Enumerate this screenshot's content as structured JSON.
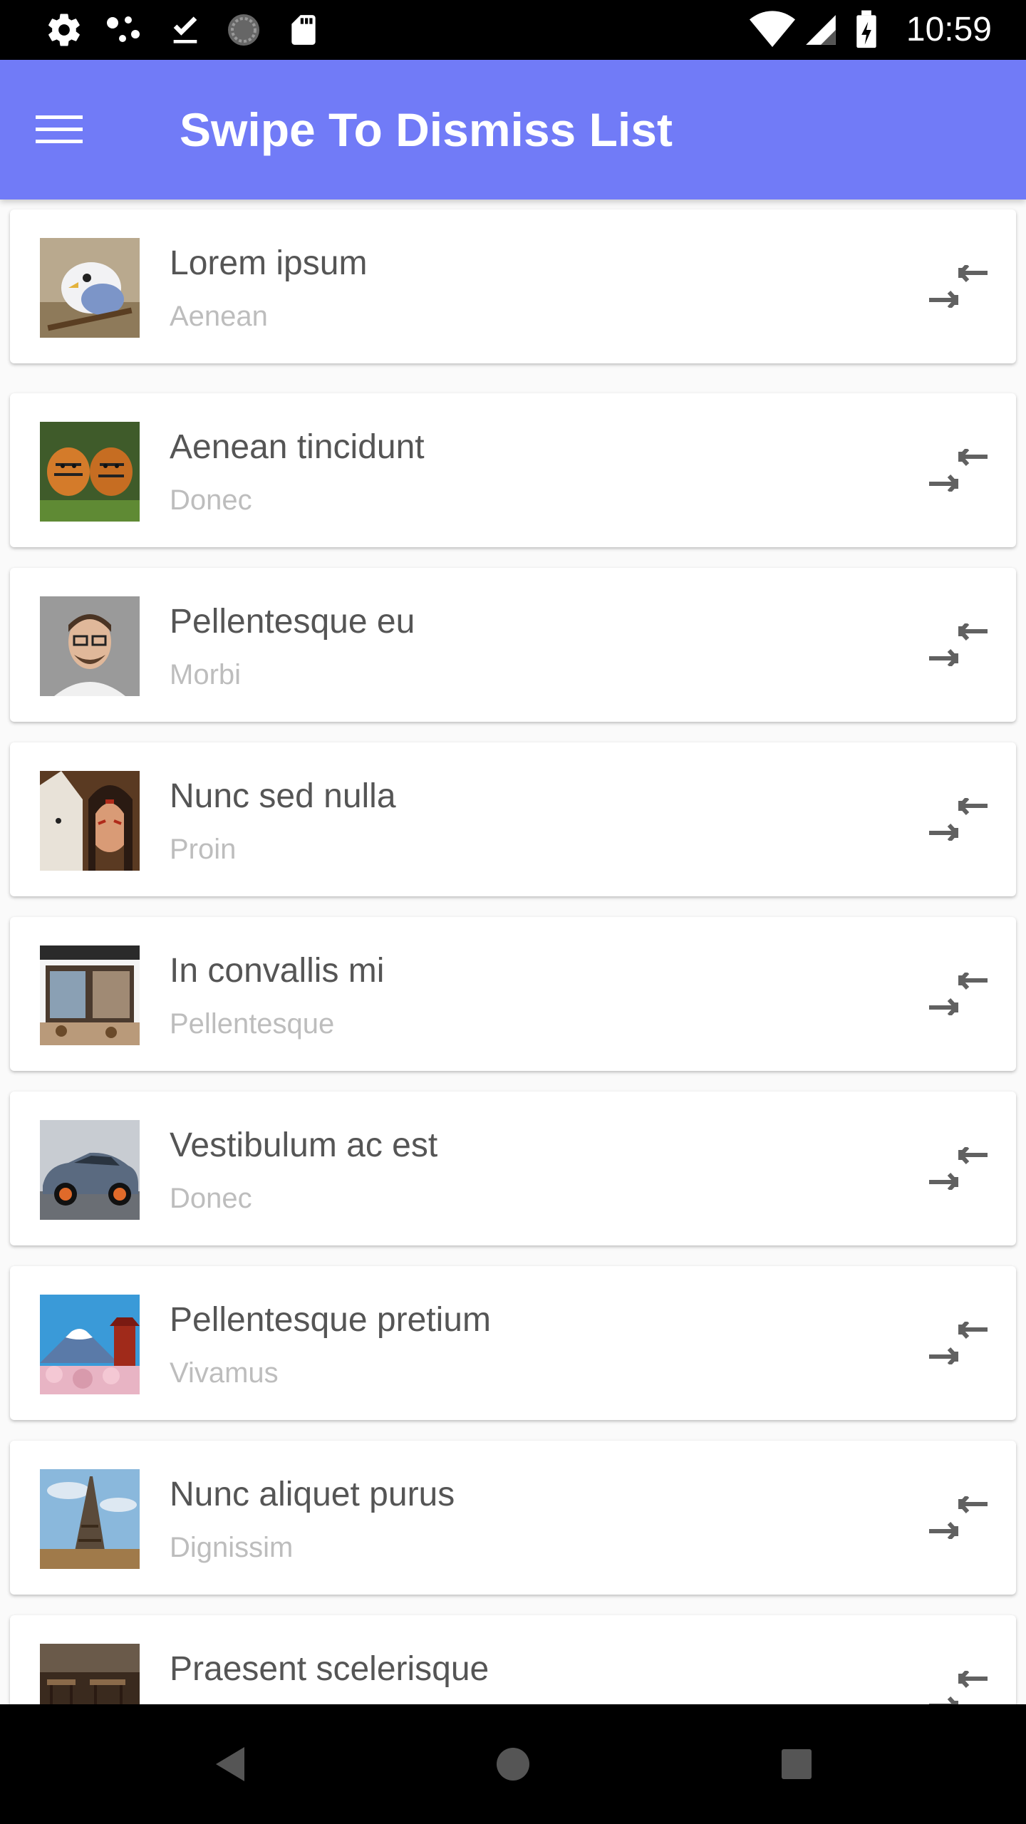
{
  "status_bar": {
    "time": "10:59",
    "icons": [
      "gear-icon",
      "dots-icon",
      "download-done-icon",
      "sync-circle-icon",
      "sd-card-icon",
      "wifi-icon",
      "signal-icon",
      "battery-charging-icon"
    ]
  },
  "app_bar": {
    "menu_icon": "hamburger-menu-icon",
    "title": "Swipe To Dismiss List",
    "color": "#717bf7"
  },
  "list": {
    "items": [
      {
        "title": "Lorem ipsum",
        "subtitle": "Aenean",
        "thumb": "bird-image",
        "action_icon": "compress-arrows-icon"
      },
      {
        "title": "Aenean tincidunt",
        "subtitle": "Donec",
        "thumb": "tigers-image",
        "action_icon": "compress-arrows-icon"
      },
      {
        "title": "Pellentesque eu",
        "subtitle": "Morbi",
        "thumb": "man-portrait-image",
        "action_icon": "compress-arrows-icon"
      },
      {
        "title": "Nunc sed nulla",
        "subtitle": "Proin",
        "thumb": "wolf-warrior-image",
        "action_icon": "compress-arrows-icon"
      },
      {
        "title": "In convallis mi",
        "subtitle": "Pellentesque",
        "thumb": "shop-front-image",
        "action_icon": "compress-arrows-icon"
      },
      {
        "title": "Vestibulum ac est",
        "subtitle": "Donec",
        "thumb": "car-image",
        "action_icon": "compress-arrows-icon"
      },
      {
        "title": "Pellentesque pretium",
        "subtitle": "Vivamus",
        "thumb": "mount-fuji-image",
        "action_icon": "compress-arrows-icon"
      },
      {
        "title": "Nunc aliquet purus",
        "subtitle": "Dignissim",
        "thumb": "eiffel-tower-image",
        "action_icon": "compress-arrows-icon"
      },
      {
        "title": "Praesent scelerisque",
        "subtitle": "",
        "thumb": "restaurant-image",
        "action_icon": "compress-arrows-icon"
      }
    ]
  },
  "nav_bar": {
    "buttons": [
      "back-triangle-icon",
      "home-circle-icon",
      "recents-square-icon"
    ]
  }
}
